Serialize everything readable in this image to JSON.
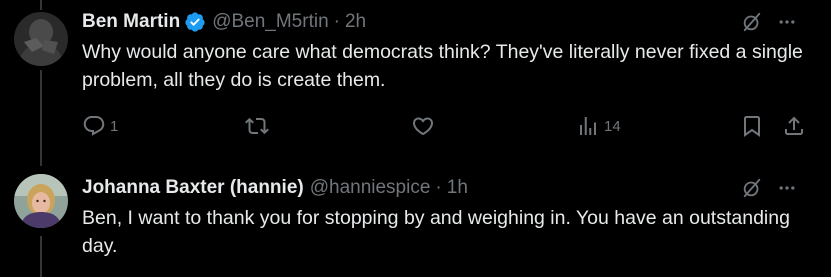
{
  "tweets": [
    {
      "display_name": "Ben Martin",
      "verified": true,
      "handle": "@Ben_M5rtin",
      "separator": "·",
      "time": "2h",
      "text": "Why would anyone care what democrats think? They've literally never fixed a single problem, all they do is create them.",
      "actions": {
        "reply_count": "1",
        "retweet_count": "",
        "like_count": "",
        "views_count": "14"
      }
    },
    {
      "display_name": "Johanna Baxter (hannie)",
      "verified": false,
      "handle": "@hanniespice",
      "separator": "·",
      "time": "1h",
      "text": "Ben, I want to thank you for stopping by and weighing in. You have an outstanding day."
    }
  ],
  "colors": {
    "background": "#000000",
    "text_primary": "#e7e9ea",
    "text_secondary": "#71767b",
    "verified_blue": "#1d9bf0",
    "thread_line": "#333639"
  },
  "icons": {
    "reply": "reply-icon",
    "retweet": "retweet-icon",
    "like": "heart-icon",
    "views": "views-icon",
    "bookmark": "bookmark-icon",
    "share": "share-icon",
    "grok": "grok-icon",
    "more": "more-icon",
    "verified": "verified-badge-icon"
  }
}
